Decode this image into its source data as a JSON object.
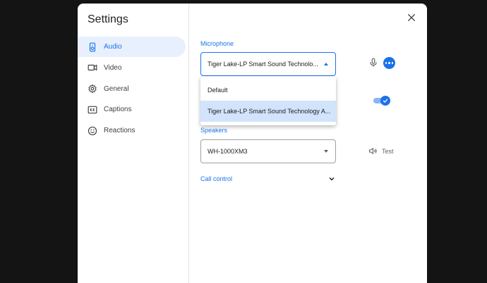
{
  "dialog": {
    "title": "Settings",
    "nav": [
      {
        "label": "Audio",
        "icon": "speaker-icon",
        "active": true
      },
      {
        "label": "Video",
        "icon": "videocam-icon"
      },
      {
        "label": "General",
        "icon": "gear-icon"
      },
      {
        "label": "Captions",
        "icon": "closed-caption-icon"
      },
      {
        "label": "Reactions",
        "icon": "smiley-icon"
      }
    ]
  },
  "audio": {
    "microphone_label": "Microphone",
    "microphone_value": "Tiger Lake-LP Smart Sound Technolo...",
    "microphone_options": [
      "Default",
      "Tiger Lake-LP Smart Sound Technology A..."
    ],
    "speakers_label": "Speakers",
    "speakers_value": "WH-1000XM3",
    "test_label": "Test",
    "call_control_label": "Call control"
  },
  "colors": {
    "accent": "#1a73e8",
    "selected_bg": "#d2e3fc",
    "active_nav_bg": "#e8f0fe",
    "backdrop": "#141414"
  }
}
